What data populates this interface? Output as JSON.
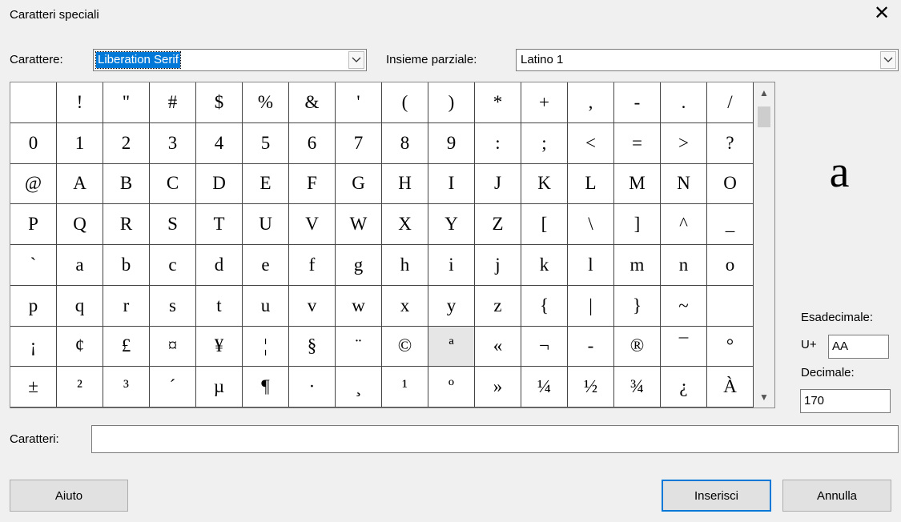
{
  "window": {
    "title": "Caratteri speciali",
    "close_glyph": "✕"
  },
  "font_selector": {
    "label": "Carattere:",
    "value": "Liberation Serif"
  },
  "subset_selector": {
    "label": "Insieme parziale:",
    "value": "Latino 1"
  },
  "grid": {
    "selected_index": 105,
    "rows": [
      [
        "",
        "!",
        "\"",
        "#",
        "$",
        "%",
        "&",
        "'",
        "(",
        ")",
        "*",
        "+",
        ",",
        "-",
        ".",
        "/"
      ],
      [
        "0",
        "1",
        "2",
        "3",
        "4",
        "5",
        "6",
        "7",
        "8",
        "9",
        ":",
        ";",
        "<",
        "=",
        ">",
        "?"
      ],
      [
        "@",
        "A",
        "B",
        "C",
        "D",
        "E",
        "F",
        "G",
        "H",
        "I",
        "J",
        "K",
        "L",
        "M",
        "N",
        "O"
      ],
      [
        "P",
        "Q",
        "R",
        "S",
        "T",
        "U",
        "V",
        "W",
        "X",
        "Y",
        "Z",
        "[",
        "\\",
        "]",
        "^",
        "_"
      ],
      [
        "`",
        "a",
        "b",
        "c",
        "d",
        "e",
        "f",
        "g",
        "h",
        "i",
        "j",
        "k",
        "l",
        "m",
        "n",
        "o"
      ],
      [
        "p",
        "q",
        "r",
        "s",
        "t",
        "u",
        "v",
        "w",
        "x",
        "y",
        "z",
        "{",
        "|",
        "}",
        "~",
        ""
      ],
      [
        "¡",
        "¢",
        "£",
        "¤",
        "¥",
        "¦",
        "§",
        "¨",
        "©",
        "ª",
        "«",
        "¬",
        "-",
        "®",
        "¯",
        "°"
      ],
      [
        "±",
        "²",
        "³",
        "´",
        "µ",
        "¶",
        "·",
        "¸",
        "¹",
        "º",
        "»",
        "¼",
        "½",
        "¾",
        "¿",
        "À"
      ]
    ]
  },
  "preview": {
    "char": "a"
  },
  "hex": {
    "label": "Esadecimale:",
    "prefix": "U+",
    "value": "AA"
  },
  "decimal": {
    "label": "Decimale:",
    "value": "170"
  },
  "characters": {
    "label": "Caratteri:",
    "value": ""
  },
  "buttons": {
    "help": "Aiuto",
    "insert": "Inserisci",
    "cancel": "Annulla"
  }
}
